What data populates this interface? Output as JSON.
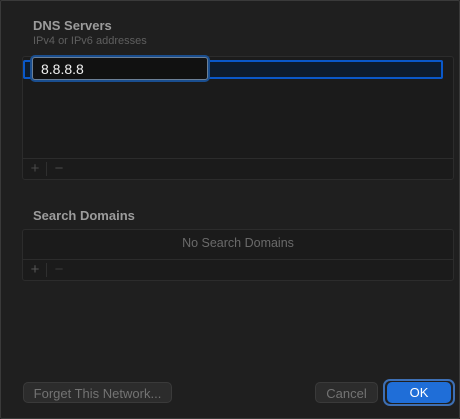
{
  "dns": {
    "title": "DNS Servers",
    "subtitle": "IPv4 or IPv6 addresses",
    "entries": [
      "8.8.8.8"
    ],
    "add_label": "+",
    "remove_label": "−"
  },
  "search_domains": {
    "title": "Search Domains",
    "empty_text": "No Search Domains",
    "add_label": "+",
    "remove_label": "−"
  },
  "buttons": {
    "forget": "Forget This Network...",
    "cancel": "Cancel",
    "ok": "OK"
  },
  "colors": {
    "accent": "#1f6ed8",
    "selection": "#0a58c9",
    "background": "#1f1f1f"
  }
}
